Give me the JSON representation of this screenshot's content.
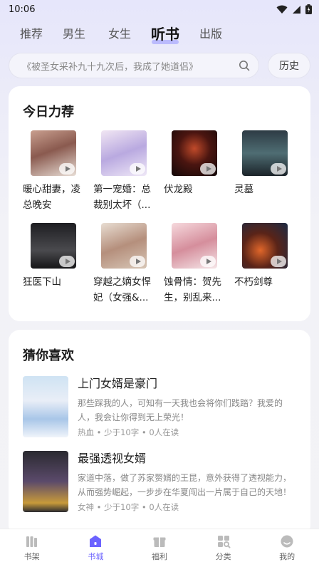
{
  "status": {
    "time": "10:06"
  },
  "tabs": [
    {
      "label": "推荐"
    },
    {
      "label": "男生"
    },
    {
      "label": "女生"
    },
    {
      "label": "听书"
    },
    {
      "label": "出版"
    }
  ],
  "search": {
    "placeholder": "《被圣女采补九十九次后，我成了她道侣》",
    "history_label": "历史"
  },
  "today": {
    "title": "今日力荐",
    "books": [
      {
        "title": "暖心甜妻，凌总晚安"
      },
      {
        "title": "第一宠婚：总裁别太坏（..."
      },
      {
        "title": "伏龙殿"
      },
      {
        "title": "灵墓"
      },
      {
        "title": "狂医下山"
      },
      {
        "title": "穿越之嫡女悍妃（女强&..."
      },
      {
        "title": "蚀骨情：贺先生，别乱来..."
      },
      {
        "title": "不朽剑尊"
      }
    ]
  },
  "guess": {
    "title": "猜你喜欢",
    "items": [
      {
        "title": "上门女婿是豪门",
        "desc": "那些踩我的人，可知有一天我也会将你们践踏？我爱的人，我会让你得到无上荣光！",
        "meta": "热血 • 少于10字 • 0人在读"
      },
      {
        "title": "最强透视女婿",
        "desc": "家道中落，做了苏家赘婿的王昆，意外获得了透视能力，从而强势崛起，一步步在华夏闯出一片属于自己的天地！",
        "meta": "女神 • 少于10字 • 0人在读"
      }
    ]
  },
  "nav": [
    {
      "label": "书架",
      "icon": "bookshelf-icon"
    },
    {
      "label": "书城",
      "icon": "bookstore-icon"
    },
    {
      "label": "福利",
      "icon": "gift-icon"
    },
    {
      "label": "分类",
      "icon": "category-icon"
    },
    {
      "label": "我的",
      "icon": "profile-icon"
    }
  ],
  "colors": {
    "accent": "#6c63ff"
  }
}
